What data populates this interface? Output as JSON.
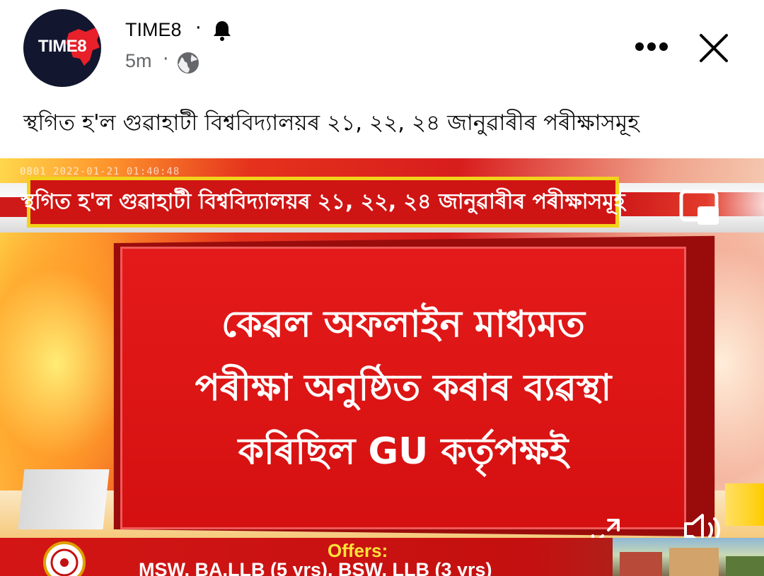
{
  "post": {
    "page_name": "TIME8",
    "name_separator": "·",
    "time": "5m",
    "time_separator": "·",
    "caption": "স্থগিত হ'ল গুৱাহাটী বিশ্ববিদ্যালয়ৰ ২১, ২২, ২৪ জানুৱাৰীৰ পৰীক্ষাসমূহ",
    "avatar_brand": "TIME8",
    "icons": {
      "notification": "bell-icon",
      "audience": "globe-icon",
      "more": "more-options-icon",
      "close": "close-icon"
    }
  },
  "media": {
    "timestamp": "0801 2022-01-21 01:40:48",
    "headline": "স্থগিত হ'ল গুৱাহাটী বিশ্ববিদ্যালয়ৰ ২১, ২২, ২৪ জানুৱাৰীৰ পৰীক্ষাসমূহ",
    "board_lines": [
      "কেৱল অফলাইন মাধ্যমত",
      "পৰীক্ষা অনুষ্ঠিত কৰাৰ ব্যৱস্থা",
      "কৰিছিল GU কৰ্তৃপক্ষই"
    ],
    "ad": {
      "offers_label": "Offers:",
      "courses": "MSW, BA.LLB (5 yrs), BSW, LLB (3 yrs)"
    },
    "icons": {
      "pip": "picture-in-picture-icon",
      "fullscreen": "expand-icon",
      "volume": "volume-icon"
    }
  },
  "colors": {
    "headline_red": "#cf1414",
    "headline_border": "#f2d21b",
    "board_red": "#e41a1a",
    "offers_yellow": "#ffe23a",
    "secondary_text": "#65676b"
  }
}
